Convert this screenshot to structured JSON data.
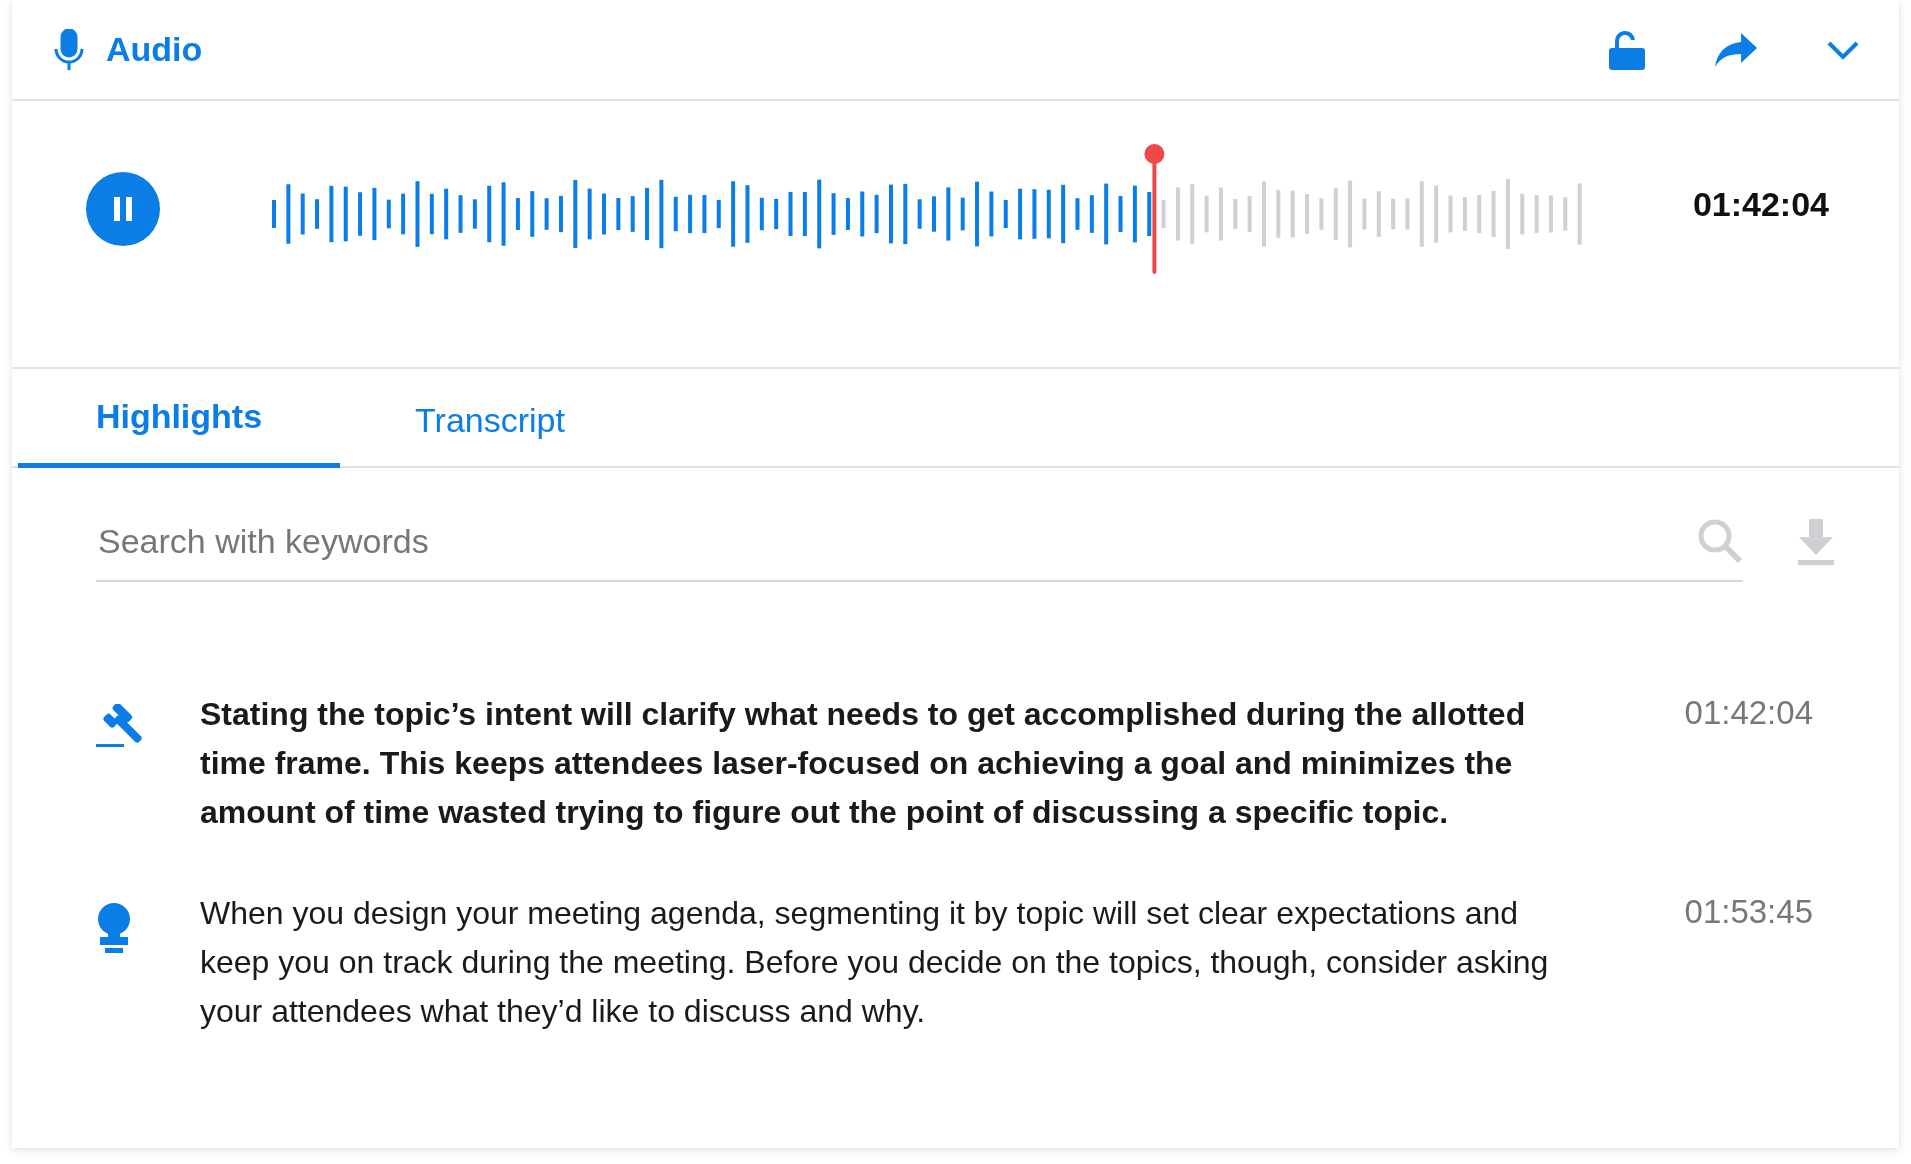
{
  "header": {
    "title": "Audio"
  },
  "player": {
    "playing": true,
    "level": 0.67,
    "time": "01:42:04"
  },
  "tabs": [
    {
      "label": "Highlights",
      "selected": true
    },
    {
      "label": "Transcript",
      "selected": false
    }
  ],
  "search": {
    "placeholder": "Search with keywords"
  },
  "highlights": [
    {
      "kind": "decision",
      "text": "Stating the topic’s intent will clarify what needs to get accomplished during the allotted time frame. This keeps attendees laser-focused on achieving a goal and minimizes the amount of time wasted trying to figure out the point of discussing a specific topic.",
      "time": "01:42:04"
    },
    {
      "kind": "idea",
      "text": "When you design your meeting agenda, segmenting it by topic will set clear expectations and keep you on track during the meeting. Before you decide on the topics, though, consider asking your attendees what they’d like to discuss and why.",
      "time": "01:53:45"
    }
  ]
}
